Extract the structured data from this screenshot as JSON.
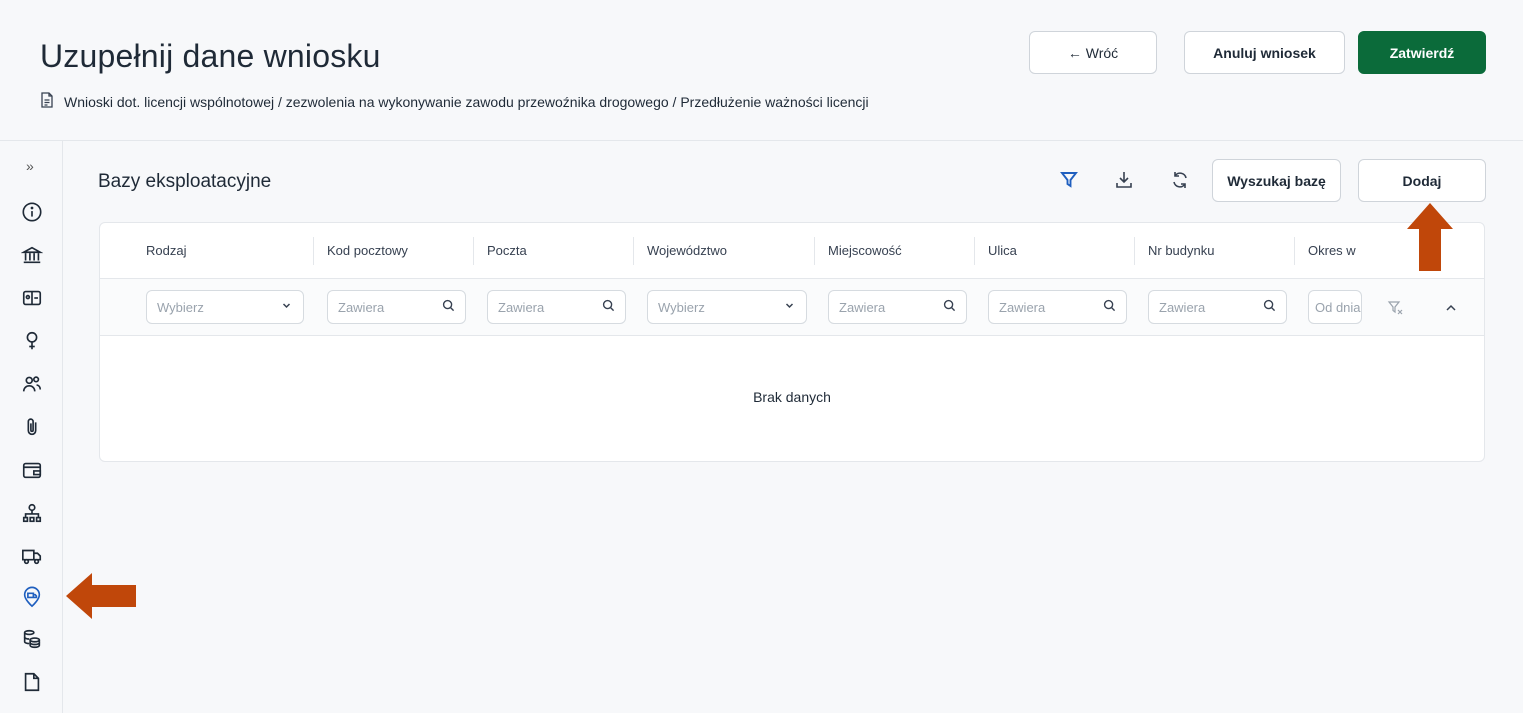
{
  "header": {
    "title": "Uzupełnij dane wniosku",
    "breadcrumb": "Wnioski dot. licencji wspólnotowej / zezwolenia na wykonywanie zawodu przewoźnika drogowego / Przedłużenie ważności licencji",
    "back_label": "← Wróć",
    "cancel_label": "Anuluj wniosek",
    "confirm_label": "Zatwierdź",
    "brand_color": "#0b6b3a"
  },
  "sidebar": {
    "expand": "»",
    "items": [
      {
        "icon": "info-icon"
      },
      {
        "icon": "bank-icon"
      },
      {
        "icon": "id-card-icon"
      },
      {
        "icon": "person-pin-icon"
      },
      {
        "icon": "people-icon"
      },
      {
        "icon": "paperclip-icon"
      },
      {
        "icon": "wallet-icon"
      },
      {
        "icon": "org-structure-icon"
      },
      {
        "icon": "truck-icon"
      },
      {
        "icon": "truck-location-icon",
        "active": true
      },
      {
        "icon": "coins-icon"
      },
      {
        "icon": "document-icon"
      }
    ],
    "active_color": "#1f5fbf"
  },
  "section": {
    "title": "Bazy eksploatacyjne",
    "search_base_label": "Wyszukaj bazę",
    "add_label": "Dodaj"
  },
  "table": {
    "columns": [
      "Rodzaj",
      "Kod pocztowy",
      "Poczta",
      "Województwo",
      "Miejscowość",
      "Ulica",
      "Nr budynku",
      "Okres w"
    ],
    "filters": [
      {
        "type": "select",
        "placeholder": "Wybierz"
      },
      {
        "type": "search",
        "placeholder": "Zawiera"
      },
      {
        "type": "search",
        "placeholder": "Zawiera"
      },
      {
        "type": "select",
        "placeholder": "Wybierz"
      },
      {
        "type": "search",
        "placeholder": "Zawiera"
      },
      {
        "type": "search",
        "placeholder": "Zawiera"
      },
      {
        "type": "search",
        "placeholder": "Zawiera"
      },
      {
        "type": "date",
        "placeholder": "Od dnia"
      }
    ],
    "empty_text": "Brak danych"
  },
  "annotations": {
    "arrow_color": "#c0470a"
  }
}
